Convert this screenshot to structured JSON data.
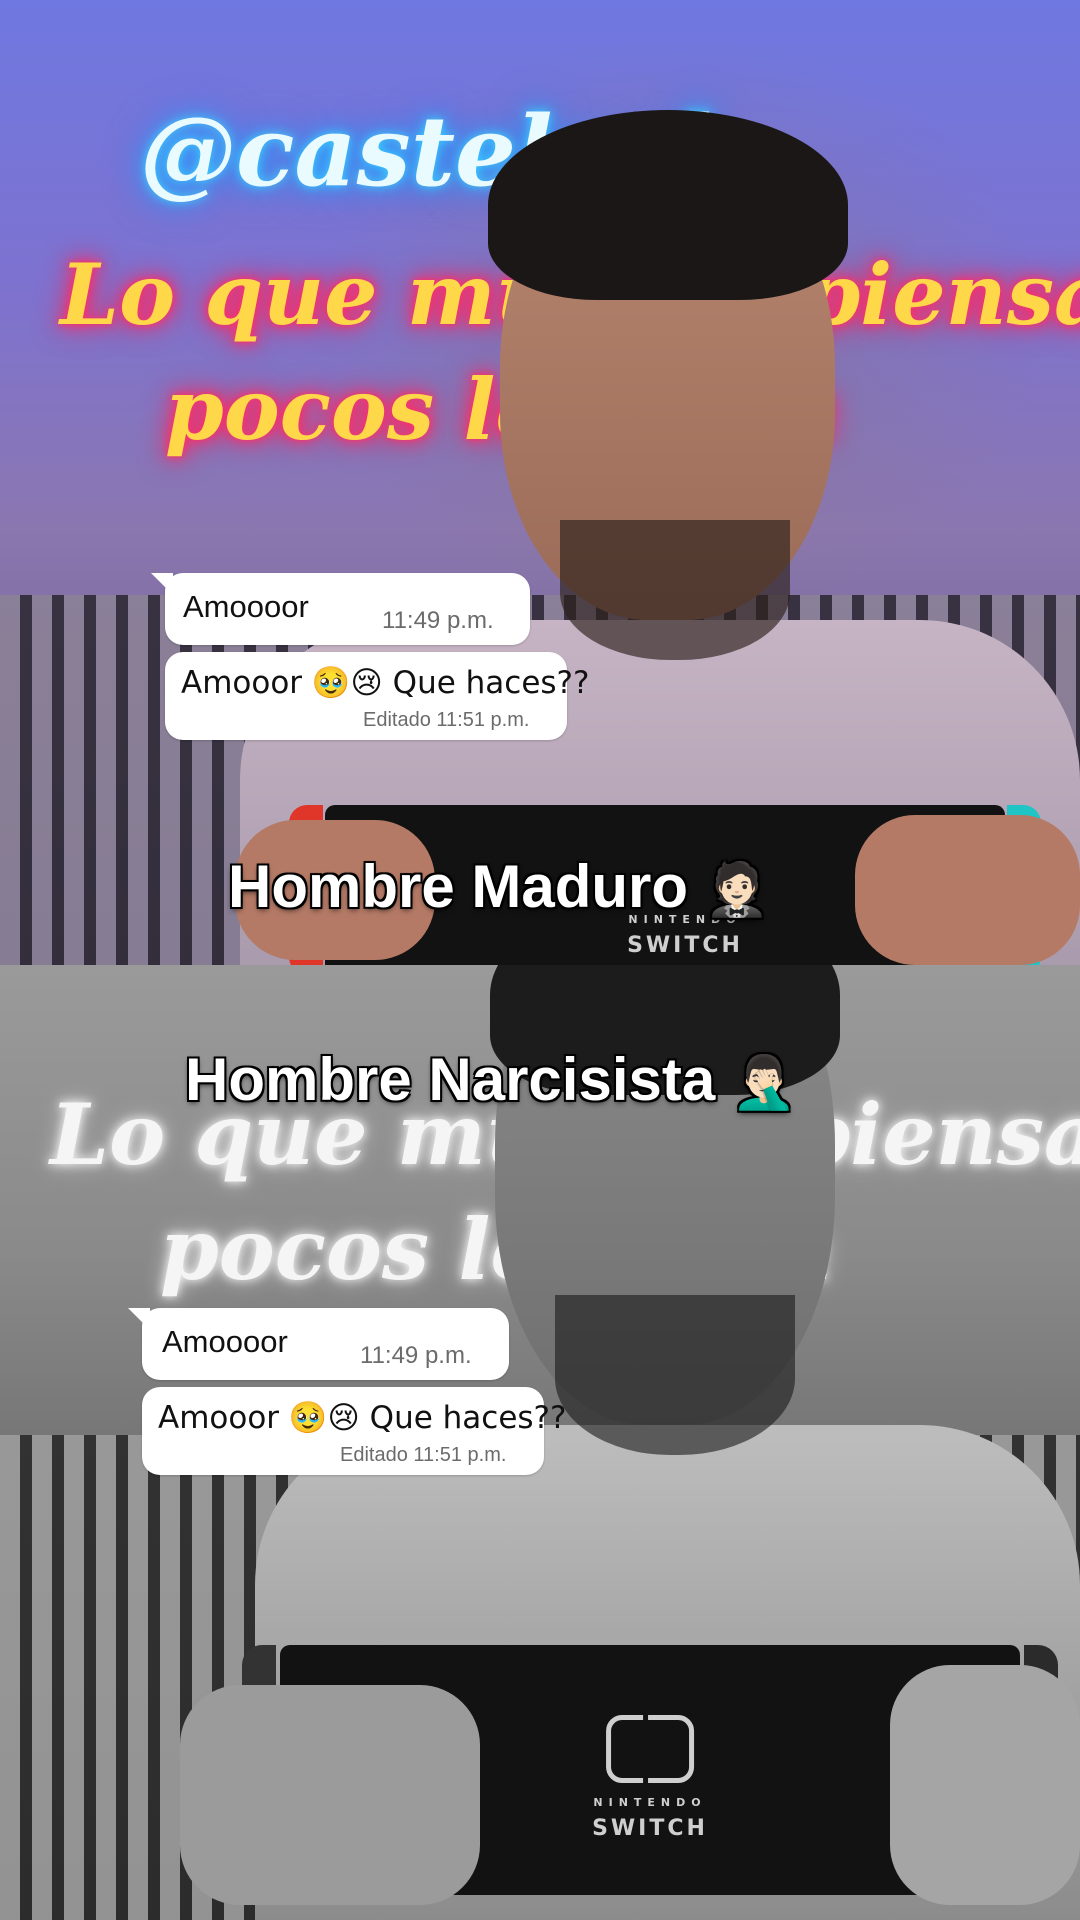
{
  "neon_sign": {
    "handle": "@castelcol",
    "line1": "Lo que muchos piensan",
    "line2": "pocos lo dicen"
  },
  "panels": [
    {
      "caption": "Hombre Maduro",
      "caption_emoji": "🤵🏻",
      "messages": [
        {
          "text": "Amoooor",
          "time": "11:49 p.m."
        },
        {
          "text": "Amooor 🥹😢 Que haces??",
          "time": "Editado 11:51 p.m."
        }
      ]
    },
    {
      "caption": "Hombre Narcisista",
      "caption_emoji": "🤦🏻‍♂️",
      "messages": [
        {
          "text": "Amoooor",
          "time": "11:49 p.m."
        },
        {
          "text": "Amooor 🥹😢 Que haces??",
          "time": "Editado 11:51 p.m."
        }
      ]
    }
  ],
  "console": {
    "word": "SWITCH",
    "brand": "NINTENDO"
  },
  "colors": {
    "bubble": "#ffffff",
    "caption_text": "#ffffff",
    "neon_cyan": "#3ad6ff",
    "neon_pink": "#ff2f6a",
    "neon_yellow": "#ffd84a"
  }
}
